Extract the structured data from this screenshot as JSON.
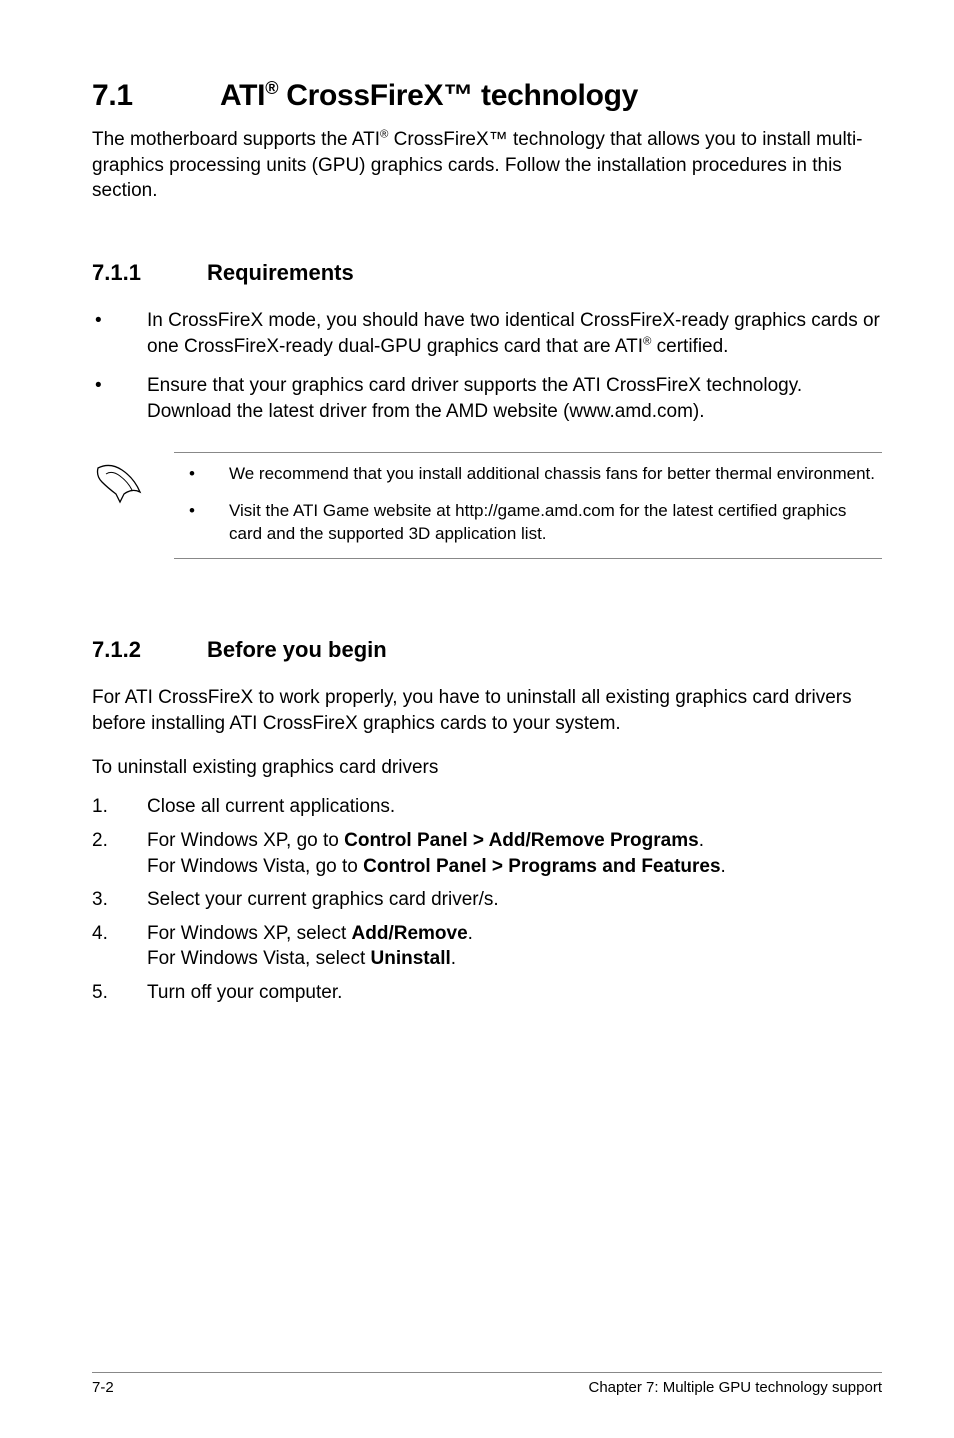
{
  "heading": {
    "number": "7.1",
    "title_pre": "ATI",
    "title_reg": "®",
    "title_post": " CrossFireX™ technology"
  },
  "intro": {
    "pre": "The motherboard supports the ATI",
    "reg": "®",
    "post": " CrossFireX™ technology that allows you to install multi-graphics processing units (GPU) graphics cards. Follow the installation procedures in this section."
  },
  "section711": {
    "num": "7.1.1",
    "title": "Requirements",
    "items": [
      {
        "pre": "In CrossFireX mode, you should have two identical CrossFireX-ready graphics cards or one CrossFireX-ready dual-GPU graphics card that are ATI",
        "reg": "®",
        "post": " certified."
      },
      {
        "pre": "Ensure that your graphics card driver supports the ATI CrossFireX technology. Download the latest driver from the AMD website (www.amd.com).",
        "reg": "",
        "post": ""
      }
    ]
  },
  "notes": [
    "We recommend that you install additional chassis fans for better thermal environment.",
    "Visit the ATI Game website at http://game.amd.com for the latest certified graphics card and the supported 3D application list."
  ],
  "section712": {
    "num": "7.1.2",
    "title": "Before you begin",
    "para": "For ATI CrossFireX to work properly, you have to uninstall all existing graphics card drivers before installing ATI CrossFireX graphics cards to your system.",
    "sub": "To uninstall existing graphics card drivers",
    "steps": [
      {
        "text": "Close all current applications."
      },
      {
        "line1_pre": "For Windows XP, go to ",
        "line1_bold": "Control Panel > Add/Remove Programs",
        "line1_post": ".",
        "line2_pre": "For Windows Vista, go to ",
        "line2_bold": "Control Panel > Programs and Features",
        "line2_post": "."
      },
      {
        "text": "Select your current graphics card driver/s."
      },
      {
        "line1_pre": "For Windows XP, select ",
        "line1_bold": "Add/Remove",
        "line1_post": ".",
        "line2_pre": "For Windows Vista, select ",
        "line2_bold": "Uninstall",
        "line2_post": "."
      },
      {
        "text": "Turn off your computer."
      }
    ]
  },
  "footer": {
    "left": "7-2",
    "right": "Chapter 7: Multiple GPU technology support"
  }
}
